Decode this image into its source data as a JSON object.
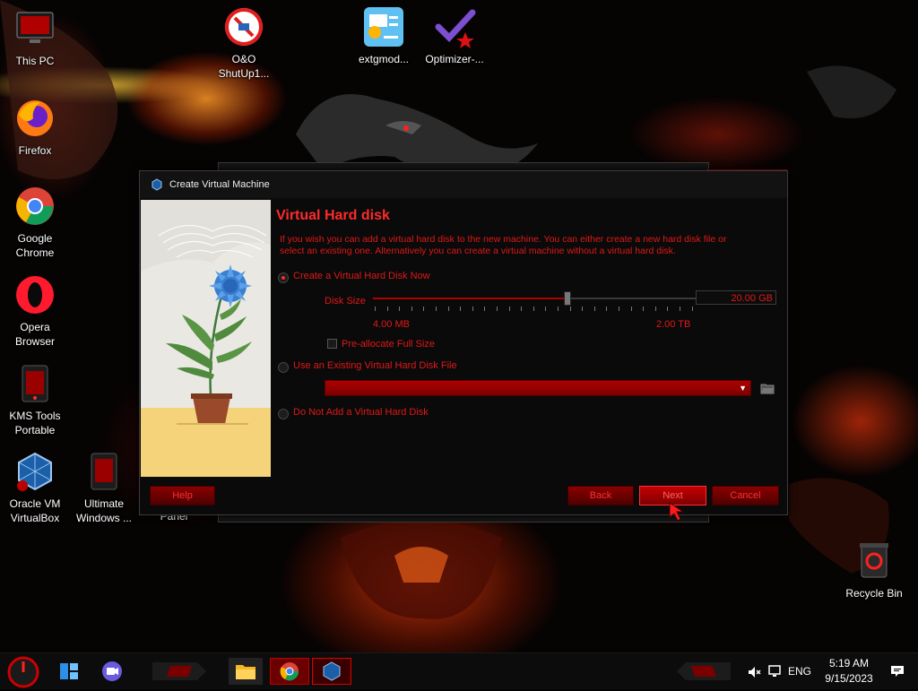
{
  "desktop": {
    "icons": [
      {
        "label": "This PC"
      },
      {
        "label": "Firefox"
      },
      {
        "label": "Google Chrome"
      },
      {
        "label": "Opera Browser"
      },
      {
        "label": "KMS Tools Portable"
      },
      {
        "label": "Oracle VM VirtualBox"
      },
      {
        "label": "Ultimate Windows ..."
      },
      {
        "label": "O&O ShutUp1..."
      },
      {
        "label": "extgmod..."
      },
      {
        "label": "Optimizer-..."
      },
      {
        "label": "Panel"
      },
      {
        "label": "Recycle Bin"
      }
    ]
  },
  "dialog": {
    "title": "Create Virtual Machine",
    "heading": "Virtual Hard disk",
    "description": "If you wish you can add a virtual hard disk to the new machine. You can either create a new hard disk file or select an existing one. Alternatively you can create a virtual machine without a virtual hard disk.",
    "options": {
      "create_new": "Create a Virtual Hard Disk Now",
      "use_existing": "Use an Existing Virtual Hard Disk File",
      "none": "Do Not Add a Virtual Hard Disk"
    },
    "selected_option": "create_new",
    "disk_size_label": "Disk Size",
    "disk_size_value": "20.00 GB",
    "slider_min": "4.00 MB",
    "slider_max": "2.00 TB",
    "slider_position": 0.6,
    "preallocate_label": "Pre-allocate Full Size",
    "preallocate_checked": false,
    "existing_disk_value": "",
    "buttons": {
      "help": "Help",
      "back": "Back",
      "next": "Next",
      "cancel": "Cancel"
    }
  },
  "taskbar": {
    "language": "ENG",
    "time": "5:19 AM",
    "date": "9/15/2023"
  },
  "theme": {
    "accent": "#ff2a2a",
    "button": "#8a0000"
  }
}
